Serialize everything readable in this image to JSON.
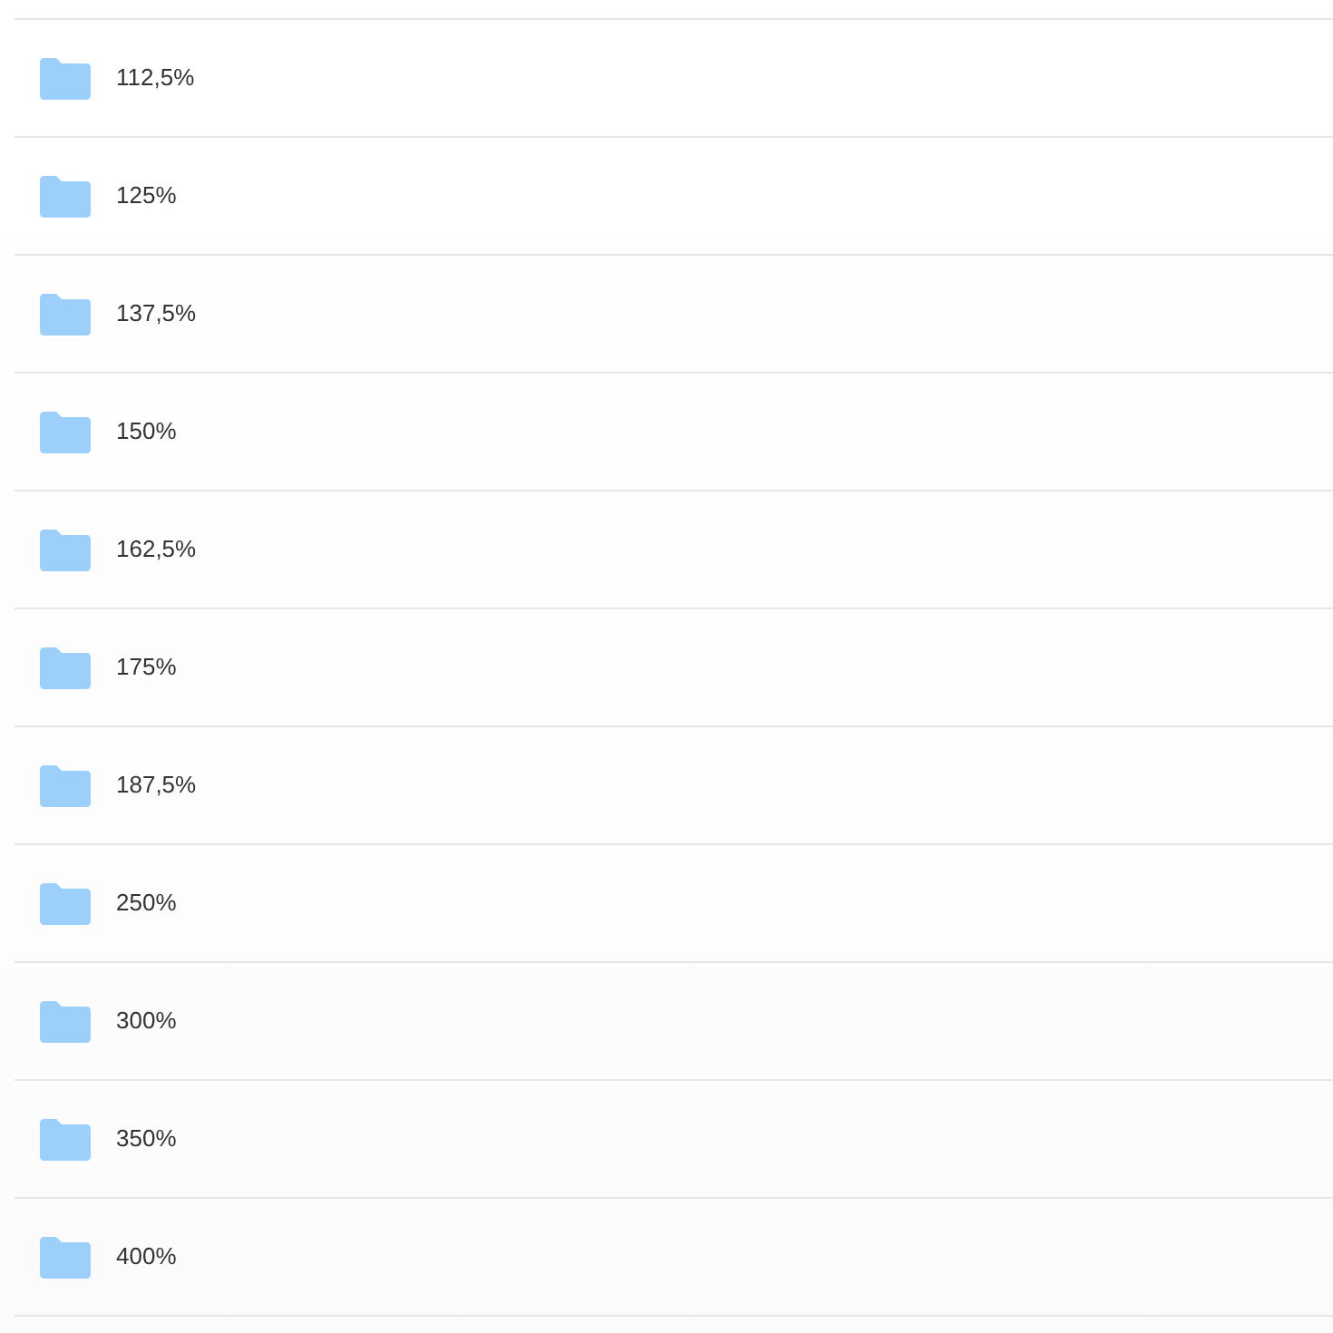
{
  "folders": [
    {
      "name": "112,5%"
    },
    {
      "name": "125%"
    },
    {
      "name": "137,5%"
    },
    {
      "name": "150%"
    },
    {
      "name": "162,5%"
    },
    {
      "name": "175%"
    },
    {
      "name": "187,5%"
    },
    {
      "name": "250%"
    },
    {
      "name": "300%"
    },
    {
      "name": "350%"
    },
    {
      "name": "400%"
    }
  ]
}
